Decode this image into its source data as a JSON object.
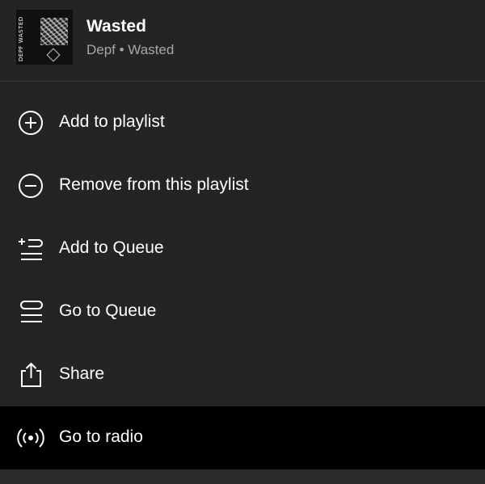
{
  "track": {
    "title": "Wasted",
    "subtitle": "Depf • Wasted",
    "cover_text": "DEPF WASTED"
  },
  "menu": {
    "items": [
      {
        "label": "Add to playlist",
        "icon": "add-circle-icon"
      },
      {
        "label": "Remove from this playlist",
        "icon": "remove-circle-icon"
      },
      {
        "label": "Add to Queue",
        "icon": "add-to-queue-icon"
      },
      {
        "label": "Go to Queue",
        "icon": "queue-icon"
      },
      {
        "label": "Share",
        "icon": "share-icon"
      },
      {
        "label": "Go to radio",
        "icon": "radio-icon",
        "highlighted": true
      }
    ]
  },
  "colors": {
    "background": "#242424",
    "highlight": "#000000",
    "text": "#ffffff",
    "subtext": "#a7a7a7"
  }
}
